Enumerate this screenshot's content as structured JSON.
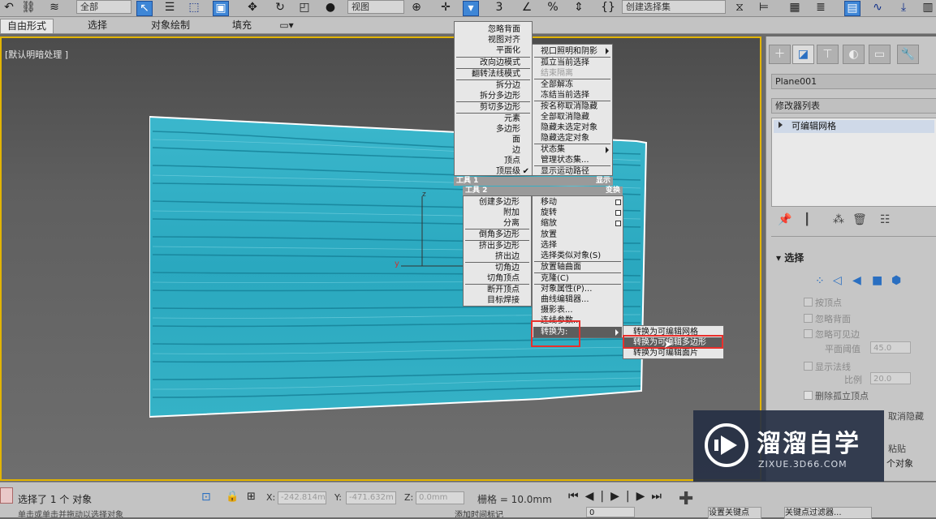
{
  "toolbar": {
    "selection_filter": "全部",
    "reference_coord": "视图",
    "named_selection": "创建选择集"
  },
  "ribbon": {
    "tabs": [
      "自由形式",
      "选择",
      "对象绘制",
      "填充"
    ]
  },
  "viewport": {
    "label": "[默认明暗处理 ]",
    "axis_x": "y",
    "axis_z": "z"
  },
  "quad_menu": {
    "display_left": [
      "忽略背面",
      "视图对齐",
      "平面化",
      "改向边模式",
      "翻转法线模式",
      "拆分边",
      "拆分多边形",
      "剪切多边形",
      "元素",
      "多边形",
      "面",
      "边",
      "顶点",
      "顶层级"
    ],
    "display_right": [
      "视口照明和阴影",
      "孤立当前选择",
      "结束隔离",
      "全部解冻",
      "冻结当前选择",
      "按名称取消隐藏",
      "全部取消隐藏",
      "隐藏未选定对象",
      "隐藏选定对象",
      "状态集",
      "管理状态集...",
      "显示运动路径"
    ],
    "header_tools1": "工具 1",
    "header_display": "显示",
    "header_tools2": "工具 2",
    "header_transform": "变换",
    "tools2_items": [
      "创建多边形",
      "附加",
      "分离",
      "倒角多边形",
      "挤出多边形",
      "挤出边",
      "切角边",
      "切角顶点",
      "断开顶点",
      "目标焊接"
    ],
    "transform_items": [
      "移动",
      "旋转",
      "缩放",
      "放置",
      "选择",
      "选择类似对象(S)",
      "放置轴曲面",
      "克隆(C)",
      "对象属性(P)...",
      "曲线编辑器...",
      "摄影表...",
      "连线参数...",
      "转换为:"
    ],
    "convert_submenu": [
      "转换为可编辑网格",
      "转换为可编辑多边形",
      "转换为可编辑面片"
    ]
  },
  "panel": {
    "object_name": "Plane001",
    "modifier_list": "修改器列表",
    "stack_item": "可编辑网格",
    "rollout_title": "选择",
    "options": [
      "按顶点",
      "忽略背面",
      "忽略可见边"
    ],
    "planar_thresh_label": "平面阈值",
    "planar_thresh_value": "45.0",
    "show_normals": "显示法线",
    "scale_label": "比例",
    "scale_value": "20.0",
    "delete_isolated": "删除孤立顶点",
    "cut_off_1": "取消隐藏",
    "cut_off_2": "粘贴",
    "cut_off_3": "个对象"
  },
  "status": {
    "selection_text": "选择了 1 个 对象",
    "prompt_text": "单击或单击并拖动以选择对象",
    "x_value": "-242.814m",
    "y_value": "-471.632m",
    "z_value": "0.0mm",
    "grid_label": "栅格 = 10.0mm",
    "add_time_tag": "添加时间标记",
    "frame_value": "0",
    "set_key": "设置关键点",
    "key_filters": "关键点过滤器..."
  },
  "watermark": {
    "title": "溜溜自学",
    "url": "ZIXUE.3D66.COM"
  },
  "colors": {
    "plane": "#2fb3c9",
    "viewport_border": "#e2b400",
    "menu_bg": "#e7e7e7",
    "highlight": "#e8302c"
  }
}
